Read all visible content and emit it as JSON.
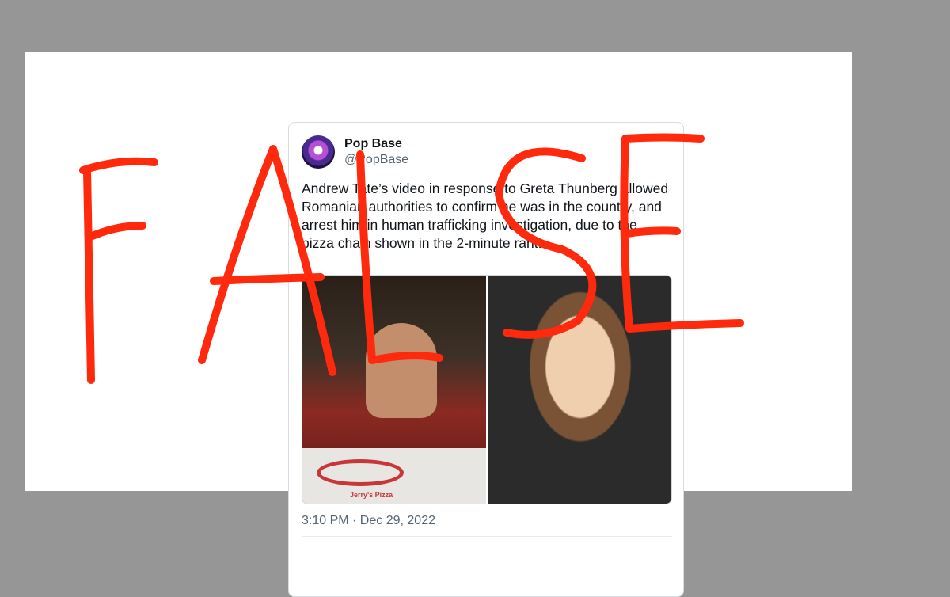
{
  "tweet": {
    "display_name": "Pop Base",
    "handle": "@PopBase",
    "text": "Andrew Tate’s video in response to Greta Thunberg allowed Romanian authorities to confirm he was in the country, and arrest him in human trafficking investigation, due to the pizza chain shown in the 2-minute rant.",
    "timestamp": "3:10 PM · Dec 29, 2022",
    "pizza_box_label": "Jerry's Pizza"
  },
  "annotation": {
    "text": "FALSE",
    "color": "#ff2a0d"
  },
  "colors": {
    "background": "#969696",
    "card": "#ffffff",
    "text_primary": "#0f1419",
    "text_secondary": "#536471"
  }
}
